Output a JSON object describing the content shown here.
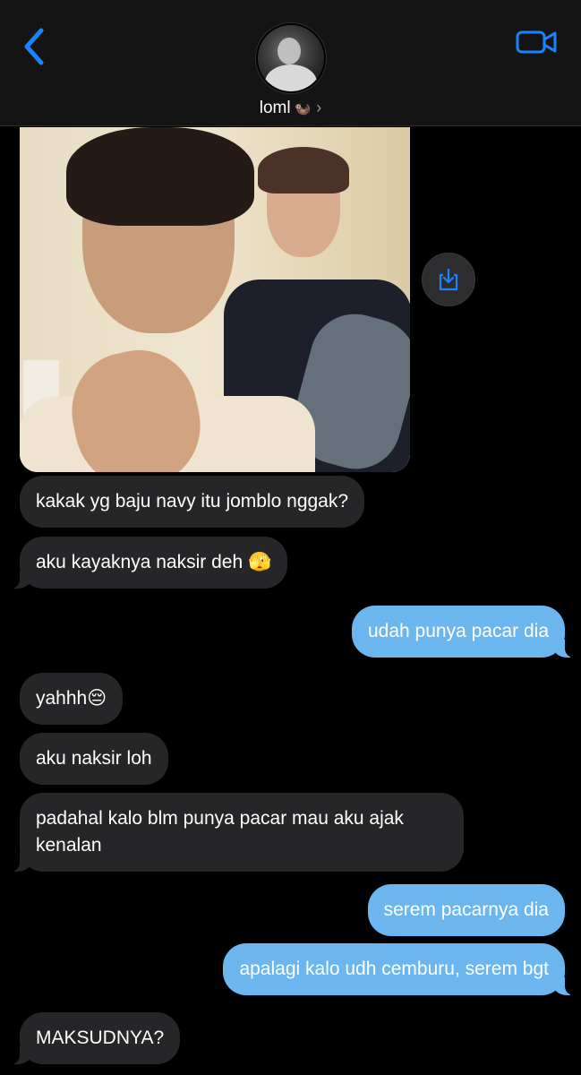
{
  "header": {
    "contact_name": "loml",
    "contact_emoji": "🦦",
    "chevron": "›",
    "back_icon": "chevron-left-icon",
    "video_icon": "video-camera-icon",
    "accent_color": "#1a84ff"
  },
  "conversation": {
    "photo": {
      "description_icon": "photo-attachment"
    },
    "save_icon": "save-download-icon",
    "messages": [
      {
        "from": "them",
        "text": "kakak yg baju navy itu jomblo nggak?"
      },
      {
        "from": "them",
        "text": "aku kayaknya naksir deh 🫣"
      },
      {
        "from": "me",
        "text": "udah punya pacar dia"
      },
      {
        "from": "them",
        "text": "yahhh😔"
      },
      {
        "from": "them",
        "text": "aku naksir loh"
      },
      {
        "from": "them",
        "text": "padahal kalo blm punya pacar mau aku ajak kenalan"
      },
      {
        "from": "me",
        "text": "serem pacarnya dia"
      },
      {
        "from": "me",
        "text": "apalagi kalo udh cemburu, serem bgt"
      },
      {
        "from": "them",
        "text": "MAKSUDNYA?"
      }
    ],
    "colors": {
      "incoming": "#262628",
      "outgoing": "#6cb6ef"
    }
  }
}
